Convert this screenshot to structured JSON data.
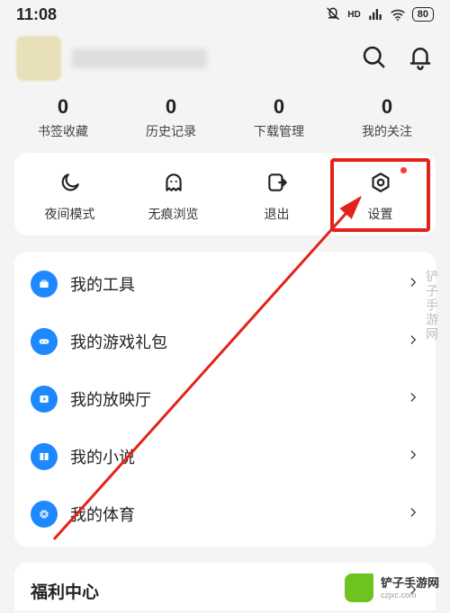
{
  "status": {
    "time": "11:08",
    "hd": "HD",
    "battery": "80"
  },
  "header": {},
  "stats": [
    {
      "num": "0",
      "label": "书签收藏"
    },
    {
      "num": "0",
      "label": "历史记录"
    },
    {
      "num": "0",
      "label": "下载管理"
    },
    {
      "num": "0",
      "label": "我的关注"
    }
  ],
  "actions": {
    "night": "夜间模式",
    "incognito": "无痕浏览",
    "exit": "退出",
    "settings": "设置"
  },
  "list": [
    {
      "label": "我的工具"
    },
    {
      "label": "我的游戏礼包"
    },
    {
      "label": "我的放映厅"
    },
    {
      "label": "我的小说"
    },
    {
      "label": "我的体育"
    }
  ],
  "section": {
    "title": "福利中心"
  },
  "watermark": {
    "text": "铲子手游网",
    "url": "czjxc.com"
  },
  "colors": {
    "brand_blue": "#1e88ff",
    "highlight_red": "#e2231a"
  }
}
